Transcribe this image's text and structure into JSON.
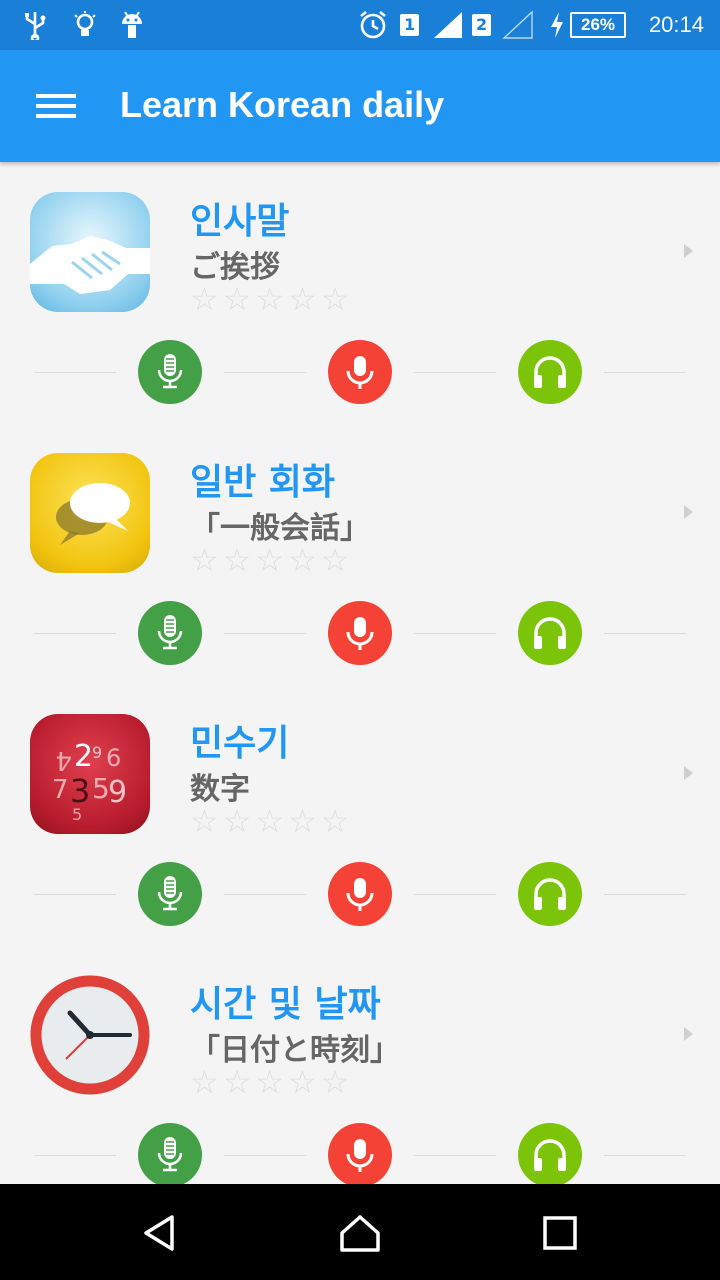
{
  "status_bar": {
    "sim1": "1",
    "sim2": "2",
    "battery": "26%",
    "time": "20:14",
    "icons": [
      "usb-icon",
      "bulb-icon",
      "android-icon",
      "alarm-icon",
      "signal-icon",
      "charging-icon",
      "battery-icon"
    ]
  },
  "app_bar": {
    "title": "Learn Korean daily"
  },
  "lessons": [
    {
      "title": "인사말",
      "subtitle": "ご挨拶",
      "rating": 0,
      "max_rating": 5,
      "stars": "☆☆☆☆☆",
      "icon": "handshake-icon"
    },
    {
      "title": "일반 회화",
      "subtitle": "「一般会話」",
      "rating": 0,
      "max_rating": 5,
      "stars": "☆☆☆☆☆",
      "icon": "chat-bubbles-icon"
    },
    {
      "title": "민수기",
      "subtitle": "数字",
      "rating": 0,
      "max_rating": 5,
      "stars": "☆☆☆☆☆",
      "icon": "numbers-icon"
    },
    {
      "title": "시간 및 날짜",
      "subtitle": "「日付と時刻」",
      "rating": 0,
      "max_rating": 5,
      "stars": "☆☆☆☆☆",
      "icon": "clock-icon"
    }
  ],
  "controls": [
    {
      "name": "microphone-icon",
      "color": "#43a047"
    },
    {
      "name": "record-icon",
      "color": "#f44336"
    },
    {
      "name": "headphones-icon",
      "color": "#7cc40a"
    }
  ],
  "colors": {
    "status_bar": "#1a7fd6",
    "app_bar": "#2196f3",
    "title_text": "#2196f3",
    "subtitle_text": "#666666",
    "background": "#f4f4f4"
  },
  "nav_bar": {
    "icons": [
      "back-icon",
      "home-icon",
      "recents-icon"
    ]
  }
}
